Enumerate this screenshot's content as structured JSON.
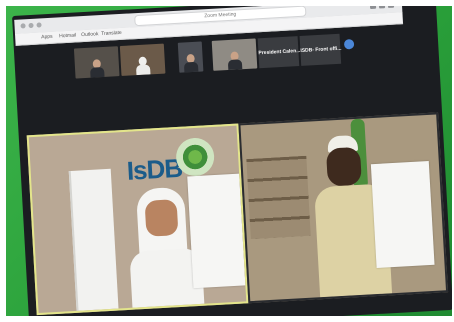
{
  "browser": {
    "url": "Zoom Meeting",
    "bookmarks": [
      "Apps",
      "Hotmail",
      "Outlook",
      "Translate"
    ]
  },
  "meeting": {
    "participant_tiles": [
      {
        "label": "President Calen..."
      },
      {
        "label": "ISDB- Front offi..."
      }
    ]
  },
  "video": {
    "left_logo_text": "IsDB"
  },
  "colors": {
    "background_green": "#2aa03a",
    "screen": "#1b1d21",
    "speaker_border": "#e3e58b"
  }
}
